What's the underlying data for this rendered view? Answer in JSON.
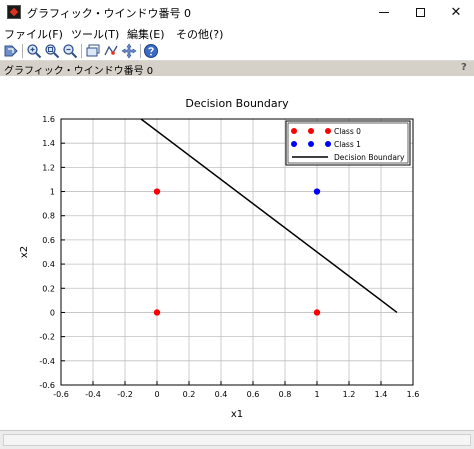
{
  "window": {
    "title": "グラフィック・ウインドウ番号 0",
    "minimize_symbol": "—",
    "maximize_symbol": "☐",
    "close_symbol": "✕"
  },
  "menubar": {
    "items": [
      {
        "label": "ファイル(F)"
      },
      {
        "label": "ツール(T)"
      },
      {
        "label": "編集(E)"
      },
      {
        "label": "その他(?)"
      }
    ]
  },
  "toolbar": {
    "icons": [
      "rotate-icon",
      "zoom-in-icon",
      "zoom-fit-icon",
      "zoom-out-icon",
      "figure-window-icon",
      "datatip-icon",
      "pan-icon",
      "help-icon"
    ]
  },
  "panel": {
    "title": "グラフィック・ウインドウ番号 0",
    "help": "?"
  },
  "colors": {
    "class0": "#ff0000",
    "class1": "#0000ff",
    "boundary": "#000000",
    "grid": "#c0c0c0"
  },
  "chart_data": {
    "type": "scatter",
    "title": "Decision Boundary",
    "xlabel": "x1",
    "ylabel": "x2",
    "xlim": [
      -0.6,
      1.6
    ],
    "ylim": [
      -0.6,
      1.6
    ],
    "x_ticks": [
      "-0.6",
      "-0.4",
      "-0.2",
      "0",
      "0.2",
      "0.4",
      "0.6",
      "0.8",
      "1",
      "1.2",
      "1.4",
      "1.6"
    ],
    "y_ticks": [
      "1.6",
      "1.4",
      "1.2",
      "1",
      "0.8",
      "0.6",
      "0.4",
      "0.2",
      "0",
      "-0.2",
      "-0.4",
      "-0.6"
    ],
    "grid": true,
    "legend_position": "top-right",
    "series": [
      {
        "name": "Class 0",
        "type": "scatter",
        "color": "#ff0000",
        "points": [
          [
            0,
            0
          ],
          [
            0,
            1
          ],
          [
            1,
            0
          ]
        ]
      },
      {
        "name": "Class 1",
        "type": "scatter",
        "color": "#0000ff",
        "points": [
          [
            1,
            1
          ]
        ]
      },
      {
        "name": "Decision Boundary",
        "type": "line",
        "color": "#000000",
        "points": [
          [
            -0.1,
            1.6
          ],
          [
            1.5,
            0
          ]
        ]
      }
    ]
  }
}
